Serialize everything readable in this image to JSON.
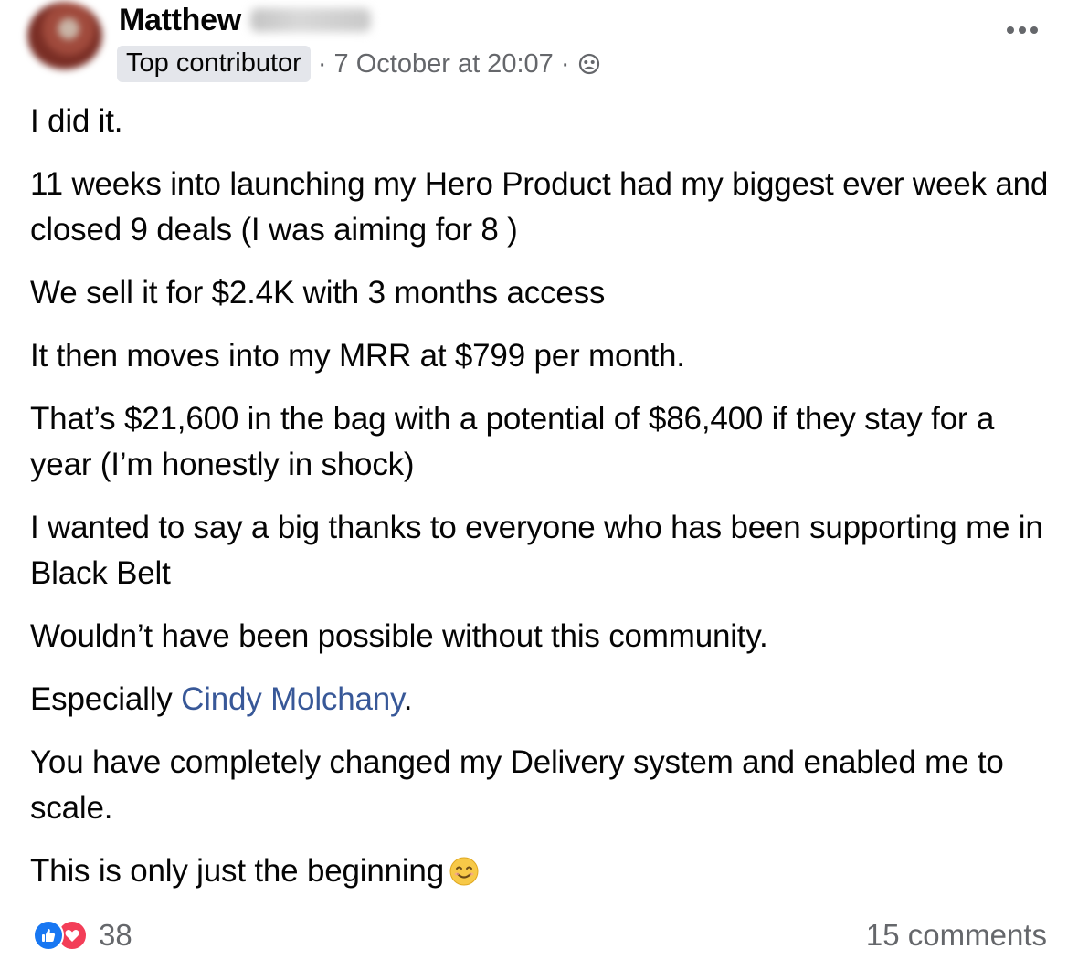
{
  "author": {
    "first_name": "Matthew",
    "badge": "Top contributor",
    "timestamp": "· 7 October at 20:07 ·",
    "audience_icon": "group-icon"
  },
  "more_menu_icon": "more-horizontal-icon",
  "body": {
    "p1": "I did it.",
    "p2": "11 weeks into launching my Hero Product had my biggest ever week and closed 9 deals (I was aiming for 8 )",
    "p3": "We sell it for $2.4K with 3 months access",
    "p4": "It then moves into my MRR at $799 per month.",
    "p5": "That’s $21,600 in the bag with a potential of $86,400 if they stay for a year (I’m honestly in shock)",
    "p6": "I wanted to say a big thanks to everyone who has been supporting me in Black Belt",
    "p7": "Wouldn’t have been possible without this community.",
    "p8_prefix": "Especially ",
    "p8_mention": "Cindy Molchany",
    "p8_suffix": ".",
    "p9": "You have completely changed my Delivery system and enabled me to scale.",
    "p10": "This is only just the beginning",
    "p10_emoji": "smiling-face-emoji"
  },
  "footer": {
    "reaction_icons": [
      "like-icon",
      "love-icon"
    ],
    "reaction_count": "38",
    "comments": "15 comments"
  },
  "colors": {
    "mention": "#385898",
    "secondary_text": "#65676b",
    "badge_bg": "#e4e6eb",
    "like_blue": "#1877f2",
    "love_red": "#f33e58"
  }
}
